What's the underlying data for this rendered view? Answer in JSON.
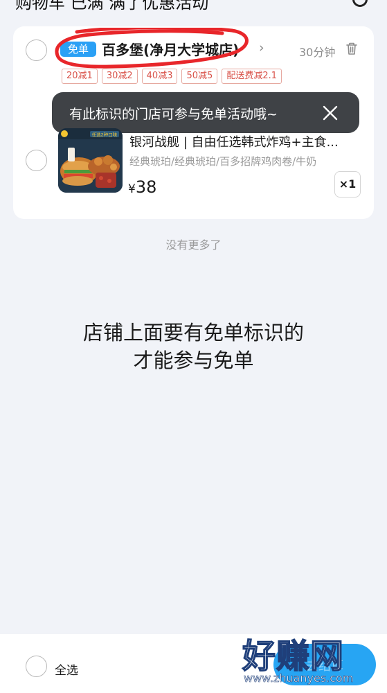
{
  "header": {
    "partial_text": "购物车 已满 满了优惠活动"
  },
  "store": {
    "badge": "免单",
    "name": "百多堡(净月大学城店)",
    "arrow": "›",
    "eta": "30分钟"
  },
  "promos": [
    "20减1",
    "30减2",
    "40减3",
    "50减5",
    "配送费减2.1"
  ],
  "tooltip": {
    "text": "有此标识的门店可参与免单活动哦~"
  },
  "item": {
    "title": "银河战舰 | 自由任选韩式炸鸡+主食...",
    "spec": "经典琥珀/经典琥珀/百多招牌鸡肉卷/牛奶",
    "currency": "¥",
    "price": "38",
    "qty": "×1",
    "thumb_label": "任选2种口味"
  },
  "list_end": "没有更多了",
  "caption": {
    "line1": "店铺上面要有免单标识的",
    "line2": "才能参与免单"
  },
  "bottom": {
    "select_all": "全选",
    "checkout_label": "去结算"
  },
  "watermark": {
    "main": "好赚网",
    "sub": "www.zhuanyes.com"
  },
  "colors": {
    "accent": "#27a5f3",
    "badge": "#2aa0f5",
    "annotation": "#e8262a",
    "tooltip_bg": "#3f4246",
    "page_bg": "#f1f3f8"
  },
  "icons": [
    "trash-icon",
    "close-icon",
    "chevron-right-icon"
  ]
}
